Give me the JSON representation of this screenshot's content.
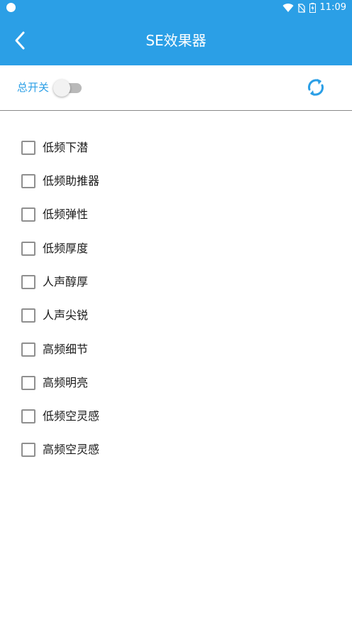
{
  "status_bar": {
    "time": "11:09"
  },
  "header": {
    "title": "SE效果器",
    "back_icon": "chevron-left-icon"
  },
  "toolbar": {
    "master_switch_label": "总开关",
    "master_switch_on": false,
    "refresh_icon": "refresh-icon"
  },
  "colors": {
    "primary": "#2b9fe6",
    "divider": "#8a8a8a",
    "text": "#1a1a1a"
  },
  "effects": [
    {
      "label": "低频下潜",
      "checked": false
    },
    {
      "label": "低频助推器",
      "checked": false
    },
    {
      "label": "低频弹性",
      "checked": false
    },
    {
      "label": "低频厚度",
      "checked": false
    },
    {
      "label": "人声醇厚",
      "checked": false
    },
    {
      "label": "人声尖锐",
      "checked": false
    },
    {
      "label": "高频细节",
      "checked": false
    },
    {
      "label": "高频明亮",
      "checked": false
    },
    {
      "label": "低频空灵感",
      "checked": false
    },
    {
      "label": "高频空灵感",
      "checked": false
    }
  ]
}
